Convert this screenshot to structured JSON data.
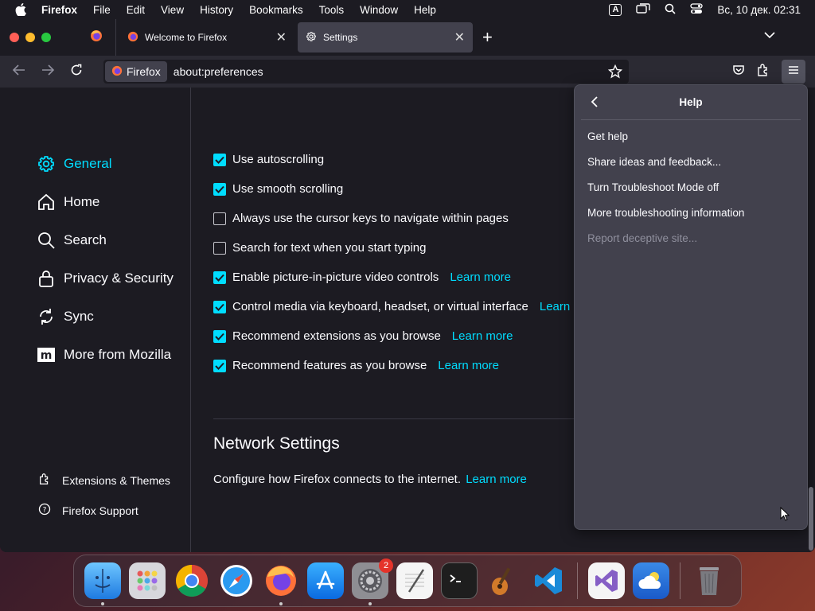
{
  "menubar": {
    "app_name": "Firefox",
    "items": [
      "File",
      "Edit",
      "View",
      "History",
      "Bookmarks",
      "Tools",
      "Window",
      "Help"
    ],
    "input_indicator": "A",
    "clock": "Вс, 10 дек. 02:31"
  },
  "tabs": {
    "items": [
      {
        "title": "Welcome to Firefox"
      },
      {
        "title": "Settings"
      }
    ]
  },
  "urlbar": {
    "identity_label": "Firefox",
    "url": "about:preferences"
  },
  "sidebar": {
    "categories": [
      {
        "label": "General",
        "icon": "gear-icon",
        "selected": true
      },
      {
        "label": "Home",
        "icon": "home-icon"
      },
      {
        "label": "Search",
        "icon": "search-icon"
      },
      {
        "label": "Privacy & Security",
        "icon": "lock-icon"
      },
      {
        "label": "Sync",
        "icon": "sync-icon"
      },
      {
        "label": "More from Mozilla",
        "icon": "mozilla-icon"
      }
    ],
    "footer": [
      {
        "label": "Extensions & Themes",
        "icon": "puzzle-icon"
      },
      {
        "label": "Firefox Support",
        "icon": "help-icon"
      }
    ]
  },
  "browsing": {
    "options": [
      {
        "label": "Use autoscrolling",
        "checked": true
      },
      {
        "label": "Use smooth scrolling",
        "checked": true
      },
      {
        "label": "Always use the cursor keys to navigate within pages",
        "checked": false
      },
      {
        "label": "Search for text when you start typing",
        "checked": false
      },
      {
        "label": "Enable picture-in-picture video controls",
        "checked": true,
        "link": "Learn more"
      },
      {
        "label": "Control media via keyboard, headset, or virtual interface",
        "checked": true,
        "link": "Learn"
      },
      {
        "label": "Recommend extensions as you browse",
        "checked": true,
        "link": "Learn more"
      },
      {
        "label": "Recommend features as you browse",
        "checked": true,
        "link": "Learn more"
      }
    ]
  },
  "network": {
    "heading": "Network Settings",
    "description": "Configure how Firefox connects to the internet.",
    "link": "Learn more"
  },
  "help_panel": {
    "title": "Help",
    "items": [
      {
        "label": "Get help",
        "enabled": true
      },
      {
        "label": "Share ideas and feedback...",
        "enabled": true
      },
      {
        "label": "Turn Troubleshoot Mode off",
        "enabled": true
      },
      {
        "label": "More troubleshooting information",
        "enabled": true
      },
      {
        "label": "Report deceptive site...",
        "enabled": false
      }
    ]
  },
  "dock": {
    "apps": [
      "finder-icon",
      "launchpad-icon",
      "chrome-icon",
      "safari-icon",
      "firefox-icon",
      "app-store-icon",
      "system-settings-icon",
      "textedit-icon",
      "terminal-icon",
      "garageband-icon",
      "vscode-icon",
      "visual-studio-icon",
      "weather-icon",
      "trash-icon"
    ],
    "system_settings_badge": "2"
  },
  "colors": {
    "accent": "#00ddff",
    "panel_bg": "#42414d",
    "window_bg": "#1c1b22"
  }
}
